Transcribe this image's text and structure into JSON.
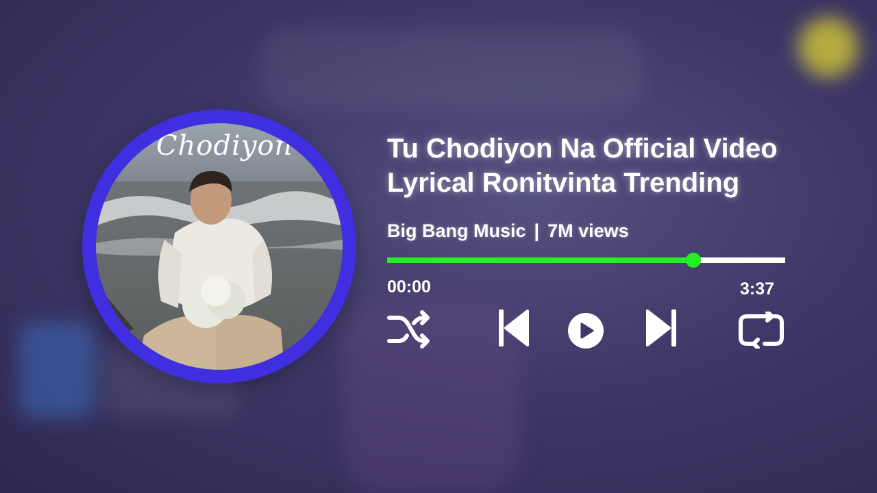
{
  "artwork": {
    "script_text": "Chodiyon N"
  },
  "track": {
    "title_line1": "Tu Chodiyon Na Official Video",
    "title_line2": "Lyrical Ronitvinta Trending",
    "channel": "Big Bang Music",
    "separator": "|",
    "views": "7M views"
  },
  "playback": {
    "current_time": "00:00",
    "total_time": "3:37",
    "progress_fraction": 0.77
  },
  "controls": [
    "shuffle-icon",
    "previous-icon",
    "play-icon",
    "next-icon",
    "repeat-icon"
  ],
  "colors": {
    "background": "#3f3868",
    "ring": "#3f2fe0",
    "progress_fill": "#22f022",
    "progress_track": "#ffffff"
  }
}
